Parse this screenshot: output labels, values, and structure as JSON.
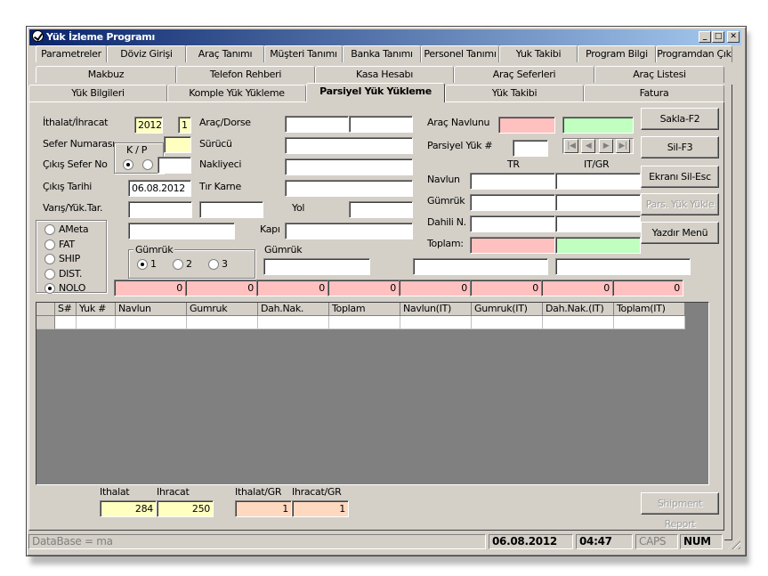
{
  "window": {
    "title": "Yük İzleme Programı",
    "controls": {
      "minimize": "_",
      "maximize": "□",
      "close": "✕"
    }
  },
  "tabs": {
    "row1": [
      "Parametreler",
      "Döviz Girişi",
      "Araç Tanımı",
      "Müşteri Tanımı",
      "Banka Tanımı",
      "Personel Tanımı",
      "Yuk Takibi",
      "Program Bilgi",
      "Programdan Çık"
    ],
    "row2": [
      "Makbuz",
      "Telefon Rehberi",
      "Kasa Hesabı",
      "Araç Seferleri",
      "Araç Listesi"
    ],
    "row3": [
      "Yük Bilgileri",
      "Komple Yük Yükleme",
      "Parsiyel Yük Yükleme",
      "Yük Takibi",
      "Fatura"
    ],
    "active": "Parsiyel Yük Yükleme"
  },
  "form": {
    "ithalat_ihracat": {
      "label": "İthalat/İhracat",
      "year": "2012",
      "code": "1"
    },
    "sefer_numarasi": {
      "label": "Sefer Numarası",
      "value": ""
    },
    "kp": {
      "label": "K / P"
    },
    "cikis_sefer_no": {
      "label": "Çıkış Sefer No",
      "value": ""
    },
    "cikis_tarihi": {
      "label": "Çıkış Tarihi",
      "value": "06.08.2012"
    },
    "varis_yuk_tar": {
      "label": "Varış/Yük.Tar.",
      "value1": "",
      "value2": ""
    },
    "arac_dorse": {
      "label": "Araç/Dorse",
      "value1": "",
      "value2": ""
    },
    "surucu": {
      "label": "Sürücü",
      "value": ""
    },
    "nakliyeci": {
      "label": "Nakliyeci",
      "value": ""
    },
    "tir_karne": {
      "label": "Tır Karne",
      "value": ""
    },
    "yol": {
      "label": "Yol",
      "value": ""
    },
    "kapi": {
      "label": "Kapı",
      "value": ""
    },
    "gumruk_label": "Gümrük",
    "gumruk_group": {
      "title": "Gümrük",
      "options": [
        "1",
        "2",
        "3"
      ],
      "selected": "1"
    },
    "type_options": [
      "AMeta",
      "FAT",
      "SHIP",
      "DIST.",
      "NOLO"
    ],
    "type_selected": "NOLO",
    "arac_navlunu": {
      "label": "Araç Navlunu",
      "tr": "",
      "it": ""
    },
    "parsiyel_yuk": {
      "label": "Parsiyel Yük #",
      "value": ""
    },
    "col_tr": "TR",
    "col_itgr": "IT/GR",
    "navlun": {
      "label": "Navlun"
    },
    "gumruk_row": {
      "label": "Gümrük"
    },
    "dahili_n": {
      "label": "Dahili N."
    },
    "toplam": {
      "label": "Toplam:"
    },
    "totals_row": [
      "0",
      "0",
      "0",
      "0",
      "0",
      "0",
      "0",
      "0"
    ]
  },
  "nav_buttons": [
    "|◀",
    "◀",
    "▶",
    "▶|"
  ],
  "buttons": {
    "sakla": "Sakla-F2",
    "sil": "Sil-F3",
    "ekrani_sil": "Ekranı Sil-Esc",
    "pars_yuk_yukle": "Pars. Yük Yükle",
    "yazdir_menu": "Yazdır Menü",
    "shipment_report": "Shipment Report"
  },
  "grid": {
    "columns": [
      "S#",
      "Yuk #",
      "Navlun",
      "Gumruk",
      "Dah.Nak.",
      "Toplam",
      "Navlun(IT)",
      "Gumruk(IT)",
      "Dah.Nak.(IT)",
      "Toplam(IT)"
    ]
  },
  "summary": {
    "ithalat_label": "Ithalat",
    "ihracat_label": "Ihracat",
    "ithalat_gr_label": "Ithalat/GR",
    "ihracat_gr_label": "Ihracat/GR",
    "ithalat": "284",
    "ihracat": "250",
    "ithalat_gr": "1",
    "ihracat_gr": "1"
  },
  "statusbar": {
    "database": "DataBase = ma",
    "date": "06.08.2012",
    "time": "04:47",
    "caps": "CAPS",
    "num": "NUM"
  }
}
